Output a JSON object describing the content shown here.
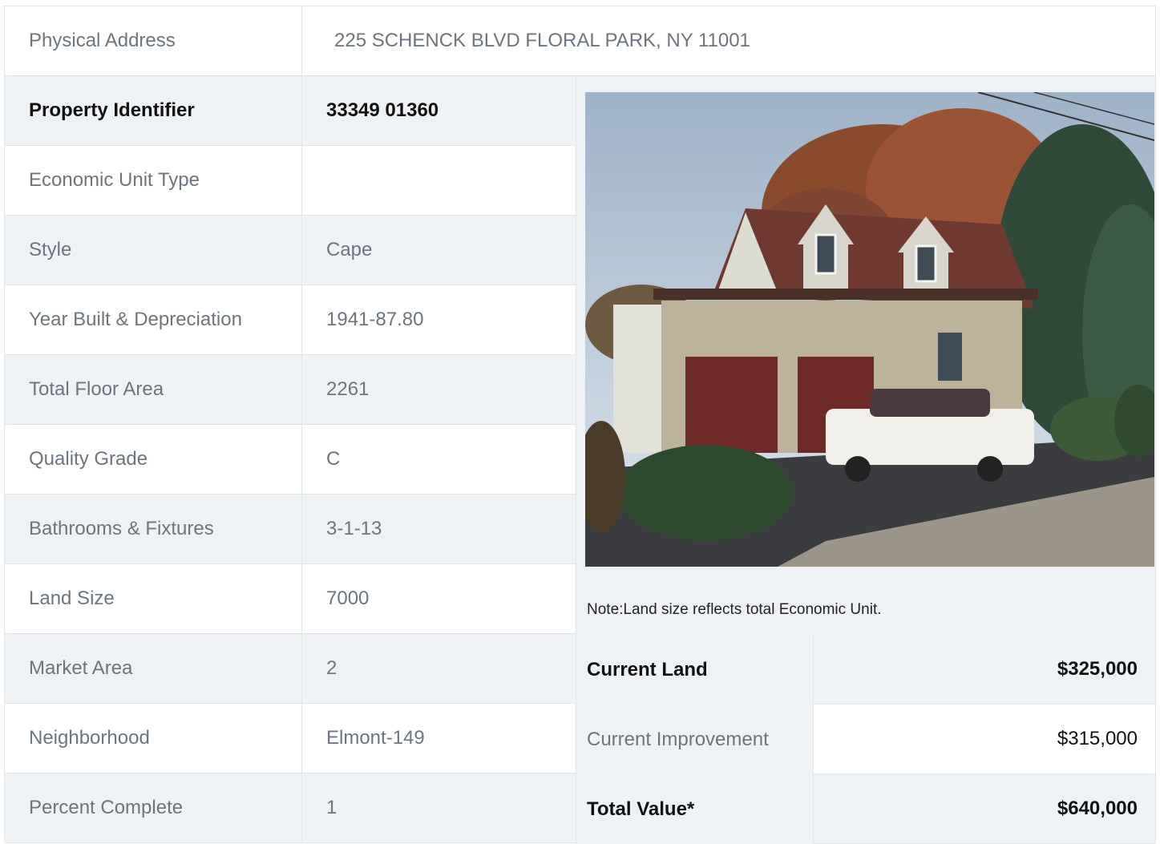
{
  "address": {
    "label": "Physical Address",
    "value": "225  SCHENCK BLVD  FLORAL PARK, NY  11001"
  },
  "property": {
    "label": "Property Identifier",
    "value": "33349  01360"
  },
  "rows": [
    {
      "label": "Economic Unit Type",
      "value": ""
    },
    {
      "label": "Style",
      "value": "Cape"
    },
    {
      "label": "Year Built & Depreciation",
      "value": "1941-87.80"
    },
    {
      "label": "Total Floor Area",
      "value": "2261"
    },
    {
      "label": "Quality Grade",
      "value": "C"
    },
    {
      "label": "Bathrooms & Fixtures",
      "value": "3-1-13"
    },
    {
      "label": "Land Size",
      "value": "7000"
    },
    {
      "label": "Market Area",
      "value": "2"
    },
    {
      "label": "Neighborhood",
      "value": "Elmont-149"
    },
    {
      "label": "Percent Complete",
      "value": "1"
    }
  ],
  "note": "Note:Land size reflects total Economic Unit.",
  "values": {
    "current_land": {
      "label": "Current Land",
      "amount": "$325,000"
    },
    "current_improvement": {
      "label": "Current Improvement",
      "amount": "$315,000"
    },
    "total_value": {
      "label": "Total Value*",
      "amount": "$640,000"
    }
  },
  "photo": {
    "icon": "house-photo"
  },
  "colors": {
    "row_alt": "#eff2f5",
    "border": "#e1e5ea",
    "label_text": "#6b7580",
    "bold_text": "#111111"
  }
}
